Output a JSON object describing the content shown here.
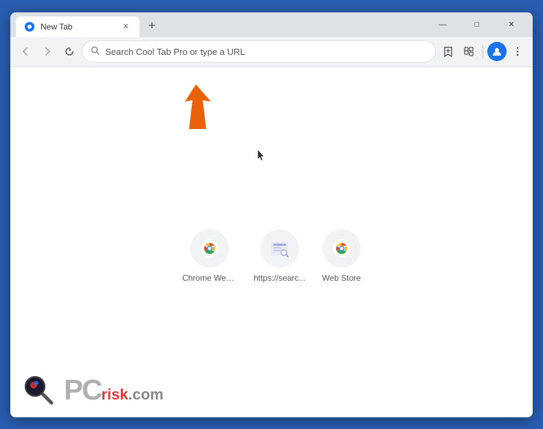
{
  "window": {
    "title": "New Tab",
    "favicon": "chrome-icon"
  },
  "titlebar": {
    "tab_label": "New Tab",
    "new_tab_btn": "+",
    "minimize": "—",
    "maximize": "□",
    "close": "✕"
  },
  "toolbar": {
    "back_btn": "‹",
    "forward_btn": "›",
    "refresh_btn": "↻",
    "address_placeholder": "Search Cool Tab Pro or type a URL",
    "bookmark_icon": "☆",
    "extensions_icon": "🧩",
    "profile_icon": "👤",
    "menu_icon": "⋮"
  },
  "shortcuts": [
    {
      "label": "Chrome Web...",
      "icon": "chrome-icon"
    },
    {
      "label": "https://searc...",
      "icon": "search-icon"
    },
    {
      "label": "Web Store",
      "icon": "chrome-icon"
    }
  ],
  "watermark": {
    "pc_text": "PC",
    "risk_text": "risk",
    "dot_com": ".com"
  }
}
